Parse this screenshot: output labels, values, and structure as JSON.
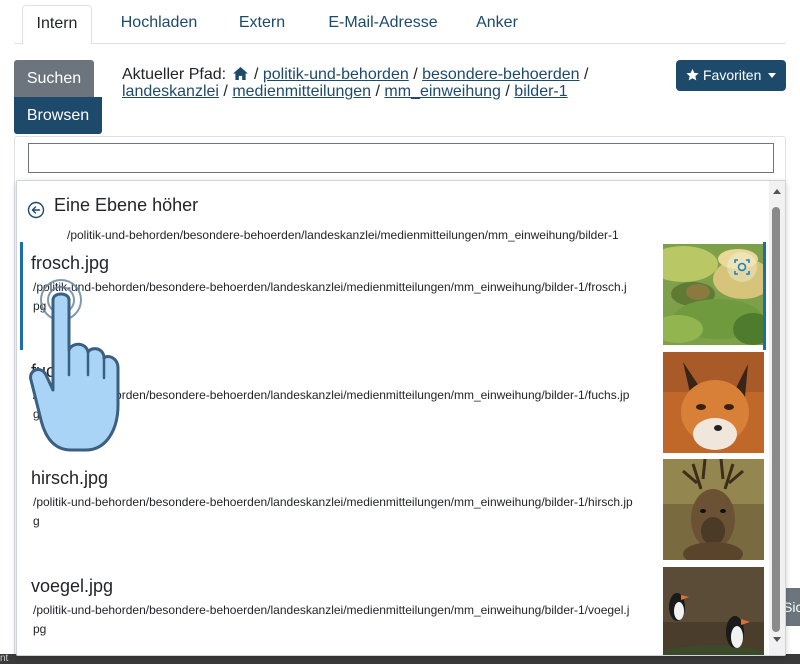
{
  "tabs": [
    {
      "label": "Intern",
      "active": true
    },
    {
      "label": "Hochladen",
      "active": false
    },
    {
      "label": "Extern",
      "active": false
    },
    {
      "label": "E-Mail-Adresse",
      "active": false
    },
    {
      "label": "Anker",
      "active": false
    }
  ],
  "mode_buttons": {
    "search": "Suchen",
    "browse": "Browsen"
  },
  "path": {
    "label": "Aktueller Pfad:",
    "home_icon": "home-icon",
    "separator": "/",
    "segments": [
      "politik-und-behorden",
      "besondere-behoerden",
      "landeskanzlei",
      "medienmitteilungen",
      "mm_einweihung",
      "bilder-1"
    ]
  },
  "favorites": {
    "label": "Favoriten",
    "icon": "star-icon"
  },
  "search": {
    "value": "",
    "placeholder": ""
  },
  "browser": {
    "up_label": "Eine Ebene höher",
    "up_icon": "arrow-left-circle-icon",
    "up_path": "/politik-und-behorden/besondere-behoerden/landeskanzlei/medienmitteilungen/mm_einweihung/bilder-1",
    "items": [
      {
        "name": "frosch.jpg",
        "path": "/politik-und-behorden/besondere-behoerden/landeskanzlei/medienmitteilungen/mm_einweihung/bilder-1/frosch.jpg",
        "selected": true
      },
      {
        "name": "fuchs.jpg",
        "path": "/politik-und-behorden/besondere-behoerden/landeskanzlei/medienmitteilungen/mm_einweihung/bilder-1/fuchs.jpg",
        "selected": false
      },
      {
        "name": "hirsch.jpg",
        "path": "/politik-und-behorden/besondere-behoerden/landeskanzlei/medienmitteilungen/mm_einweihung/bilder-1/hirsch.jpg",
        "selected": false
      },
      {
        "name": "voegel.jpg",
        "path": "/politik-und-behorden/besondere-behoerden/landeskanzlei/medienmitteilungen/mm_einweihung/bilder-1/voegel.jpg",
        "selected": false
      }
    ]
  },
  "background": {
    "button_fragment": "Sic",
    "bottom_fragment": "nt"
  },
  "colors": {
    "primary": "#1d4a6b",
    "secondary": "#6c757d",
    "selected_border": "#1a6fa8"
  }
}
